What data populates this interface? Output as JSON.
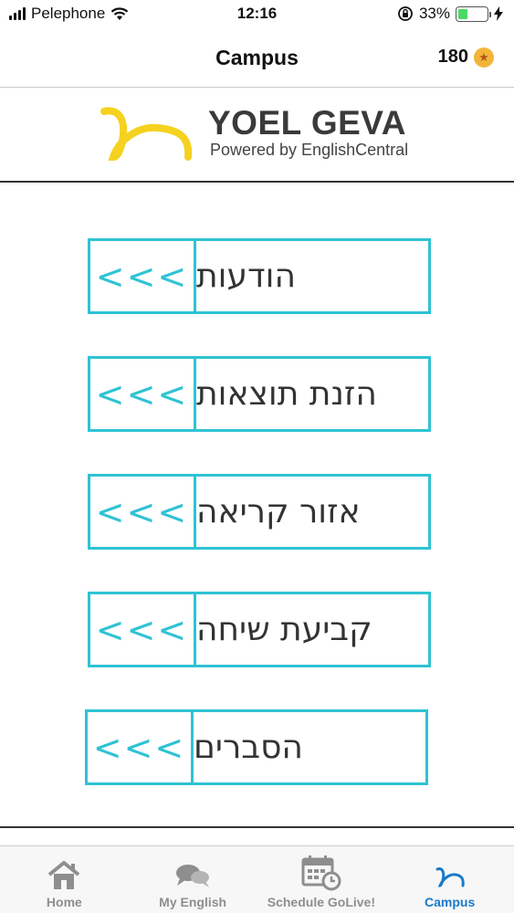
{
  "status_bar": {
    "carrier": "Pelephone",
    "time": "12:16",
    "battery_percent": "33%",
    "battery_level": 0.33
  },
  "nav": {
    "title": "Campus",
    "coins": "180"
  },
  "logo": {
    "title": "YOEL GEVA",
    "subtitle": "Powered by EnglishCentral"
  },
  "menu": {
    "items": [
      {
        "label": "הודעות",
        "arrow": "<<<"
      },
      {
        "label": "הזנת תוצאות",
        "arrow": "<<<"
      },
      {
        "label": "אזור קריאה",
        "arrow": "<<<"
      },
      {
        "label": "קביעת שיחה",
        "arrow": "<<<"
      },
      {
        "label": "הסברים",
        "arrow": "<<<"
      }
    ]
  },
  "tabs": [
    {
      "label": "Home",
      "icon": "home-icon"
    },
    {
      "label": "My English",
      "icon": "chat-bubbles-icon"
    },
    {
      "label": "Schedule GoLive!",
      "icon": "calendar-clock-icon"
    },
    {
      "label": "Campus",
      "icon": "campus-logo-icon"
    }
  ],
  "colors": {
    "accent": "#2ec3d4",
    "tab_active": "#1a79c9",
    "logo_yellow": "#f5d21f",
    "coin": "#f2b53a"
  }
}
